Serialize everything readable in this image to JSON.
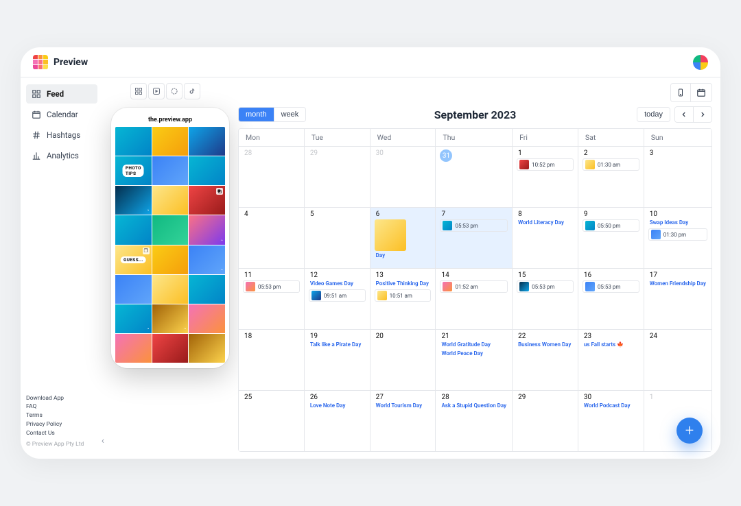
{
  "brand": {
    "name": "Preview"
  },
  "sidebar": {
    "items": [
      {
        "label": "Feed",
        "active": true
      },
      {
        "label": "Calendar",
        "active": false
      },
      {
        "label": "Hashtags",
        "active": false
      },
      {
        "label": "Analytics",
        "active": false
      }
    ]
  },
  "footer": {
    "links": [
      "Download App",
      "FAQ",
      "Terms",
      "Privacy Policy",
      "Contact Us"
    ],
    "copyright": "© Preview App Pty Ltd"
  },
  "phone": {
    "handle": "the.preview.app"
  },
  "ig_badges": {
    "photo_tips": "PHOTO TIPS",
    "guess": "GUESS..."
  },
  "calendar": {
    "title": "September 2023",
    "view": {
      "month": "month",
      "week": "week"
    },
    "today_label": "today",
    "dow": [
      "Mon",
      "Tue",
      "Wed",
      "Thu",
      "Fri",
      "Sat",
      "Sun"
    ]
  },
  "cells": [
    {
      "num": "28",
      "out": true
    },
    {
      "num": "29",
      "out": true
    },
    {
      "num": "30",
      "out": true
    },
    {
      "num": "31",
      "out": true,
      "circle": true
    },
    {
      "num": "1",
      "posts": [
        {
          "time": "10:52 pm",
          "cls": "tF"
        }
      ]
    },
    {
      "num": "2",
      "posts": [
        {
          "time": "01:30 am",
          "cls": "tK"
        }
      ]
    },
    {
      "num": "3"
    },
    {
      "num": "4"
    },
    {
      "num": "5"
    },
    {
      "num": "6",
      "big": "tK",
      "holiday": "Day",
      "sel": true
    },
    {
      "num": "7",
      "posts": [
        {
          "time": "05:53 pm",
          "cls": "tA"
        }
      ],
      "sel": true
    },
    {
      "num": "8",
      "holiday": "World Literacy Day"
    },
    {
      "num": "9",
      "posts": [
        {
          "time": "05:50 pm",
          "cls": "tA"
        }
      ]
    },
    {
      "num": "10",
      "holiday": "Swap Ideas Day",
      "posts": [
        {
          "time": "01:30 pm",
          "cls": "tJ"
        }
      ]
    },
    {
      "num": "11",
      "posts": [
        {
          "time": "05:53 pm",
          "cls": "tG"
        }
      ]
    },
    {
      "num": "12",
      "holiday": "Video Games Day",
      "posts": [
        {
          "time": "09:51 am",
          "cls": "tC"
        }
      ]
    },
    {
      "num": "13",
      "holiday": "Positive Thinking Day",
      "posts": [
        {
          "time": "10:51 am",
          "cls": "tK"
        }
      ]
    },
    {
      "num": "14",
      "posts": [
        {
          "time": "01:52 am",
          "cls": "tG"
        }
      ]
    },
    {
      "num": "15",
      "posts": [
        {
          "time": "05:53 pm",
          "cls": "tH"
        }
      ]
    },
    {
      "num": "16",
      "posts": [
        {
          "time": "05:53 pm",
          "cls": "tJ"
        }
      ]
    },
    {
      "num": "17",
      "holiday": "Women Friendship Day"
    },
    {
      "num": "18"
    },
    {
      "num": "19",
      "holiday": "Talk like a Pirate Day"
    },
    {
      "num": "20"
    },
    {
      "num": "21",
      "holiday": "World Gratitude Day",
      "holiday2": "World Peace Day"
    },
    {
      "num": "22",
      "holiday": "Business Women Day"
    },
    {
      "num": "23",
      "holiday": "us Fall starts 🍁"
    },
    {
      "num": "24"
    },
    {
      "num": "25"
    },
    {
      "num": "26",
      "holiday": "Love Note Day"
    },
    {
      "num": "27",
      "holiday": "World Tourism Day"
    },
    {
      "num": "28",
      "holiday": "Ask a Stupid Question Day"
    },
    {
      "num": "29"
    },
    {
      "num": "30",
      "holiday": "World Podcast Day"
    },
    {
      "num": "1",
      "out": true
    }
  ]
}
